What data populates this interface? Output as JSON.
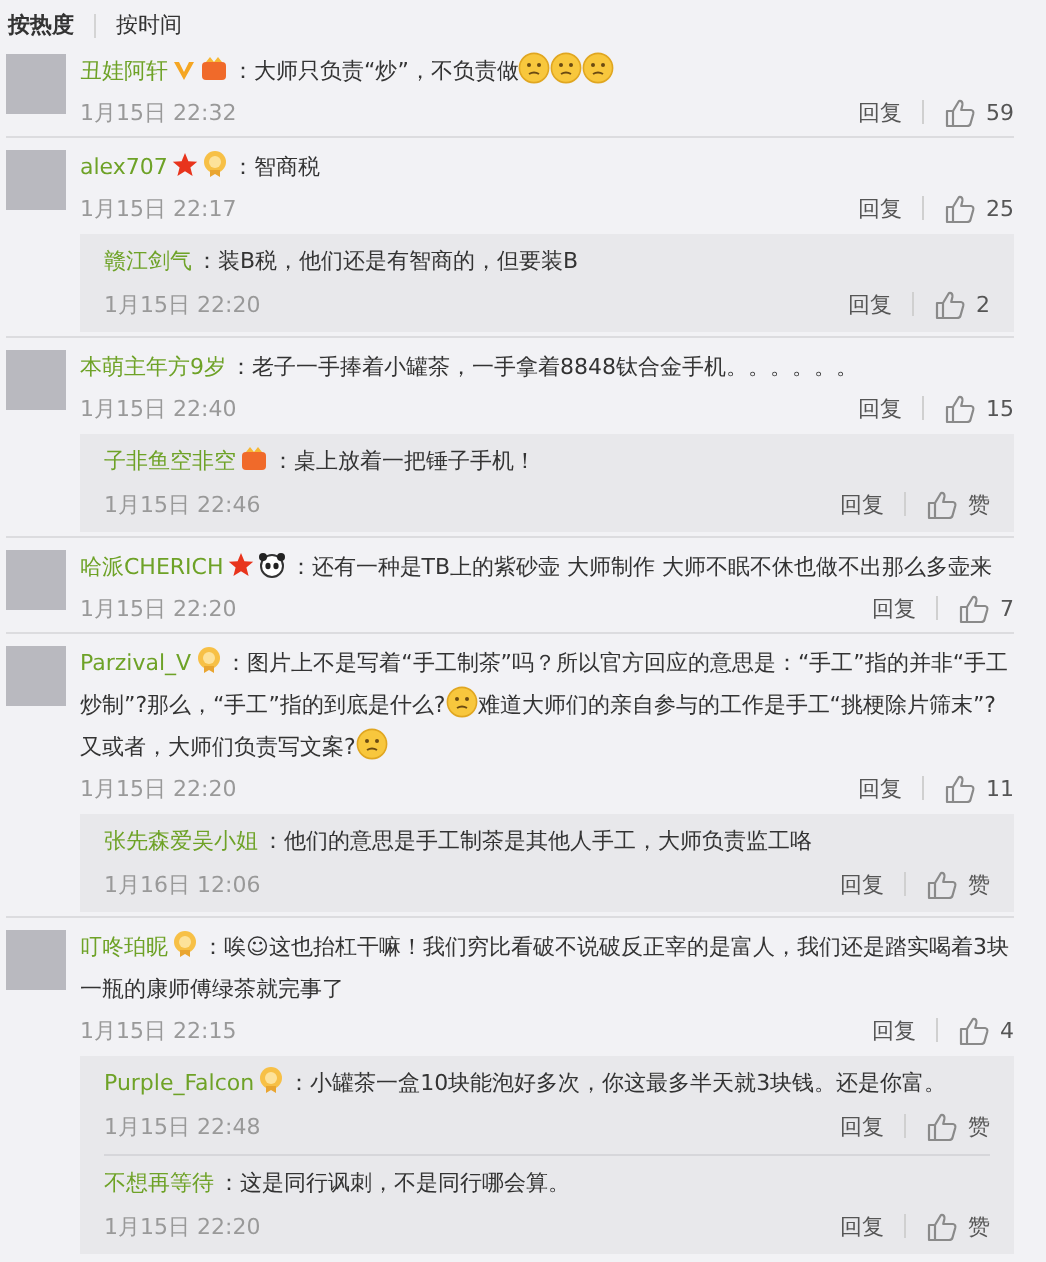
{
  "sort_tabs": [
    {
      "label": "按热度",
      "selected": true
    },
    {
      "label": "按时间",
      "selected": false
    }
  ],
  "comments": [
    {
      "user": "丑娃阿轩",
      "badges": [
        {
          "kind": "verified"
        },
        {
          "kind": "vip"
        }
      ],
      "content": [
        {
          "kind": "text",
          "text": "：大师只负责“炒”，不负责做"
        },
        {
          "kind": "emoticon"
        },
        {
          "kind": "emoticon"
        },
        {
          "kind": "emoticon"
        }
      ],
      "time": "1月15日 22:32",
      "reply_label": "回复",
      "likes": "59"
    },
    {
      "user": "alex707",
      "badges": [
        {
          "kind": "star"
        },
        {
          "kind": "medal"
        }
      ],
      "content": [
        {
          "kind": "text",
          "text": "：智商税"
        }
      ],
      "time": "1月15日 22:17",
      "reply_label": "回复",
      "likes": "25",
      "replies": [
        {
          "user": "赣江剑气",
          "content": [
            {
              "kind": "text",
              "text": "：装B税，他们还是有智商的，但要装B"
            }
          ],
          "time": "1月15日 22:20",
          "reply_label": "回复",
          "likes": "2"
        }
      ]
    },
    {
      "user": "本萌主年方9岁",
      "content": [
        {
          "kind": "text",
          "text": "：老子一手捧着小罐茶，一手拿着8848钛合金手机。。。。。。"
        }
      ],
      "time": "1月15日 22:40",
      "reply_label": "回复",
      "likes": "15",
      "replies": [
        {
          "user": "子非鱼空非空",
          "badges": [
            {
              "kind": "vip"
            }
          ],
          "content": [
            {
              "kind": "text",
              "text": "：桌上放着一把锤子手机！"
            }
          ],
          "time": "1月15日 22:46",
          "reply_label": "回复",
          "likes": "赞"
        }
      ]
    },
    {
      "user": "哈派CHERICH",
      "badges": [
        {
          "kind": "star"
        },
        {
          "kind": "panda"
        }
      ],
      "content": [
        {
          "kind": "text",
          "text": "：还有一种是TB上的紫砂壶 大师制作 大师不眠不休也做不出那么多壶来"
        }
      ],
      "time": "1月15日 22:20",
      "reply_label": "回复",
      "likes": "7"
    },
    {
      "user": "Parzival_V",
      "badges": [
        {
          "kind": "medal"
        }
      ],
      "content": [
        {
          "kind": "text",
          "text": "：图片上不是写着“手工制茶”吗？所以官方回应的意思是：“手工”指的并非“手工炒制”?那么，“手工”指的到底是什么?"
        },
        {
          "kind": "emoticon"
        },
        {
          "kind": "text",
          "text": "难道大师们的亲自参与的工作是手工“挑梗除片筛末”?又或者，大师们负责写文案?"
        },
        {
          "kind": "emoticon"
        }
      ],
      "time": "1月15日 22:20",
      "reply_label": "回复",
      "likes": "11",
      "replies": [
        {
          "user": "张先森爱吴小姐",
          "content": [
            {
              "kind": "text",
              "text": "：他们的意思是手工制茶是其他人手工，大师负责监工咯"
            }
          ],
          "time": "1月16日 12:06",
          "reply_label": "回复",
          "likes": "赞"
        }
      ]
    },
    {
      "user": "叮咚珀昵",
      "badges": [
        {
          "kind": "medal"
        }
      ],
      "content": [
        {
          "kind": "text",
          "text": "：唉☺这也抬杠干嘛！我们穷比看破不说破反正宰的是富人，我们还是踏实喝着3块一瓶的康师傅绿茶就完事了"
        }
      ],
      "time": "1月15日 22:15",
      "reply_label": "回复",
      "likes": "4",
      "replies": [
        {
          "user": "Purple_Falcon",
          "badges": [
            {
              "kind": "medal"
            }
          ],
          "content": [
            {
              "kind": "text",
              "text": "：小罐茶一盒10块能泡好多次，你这最多半天就3块钱。还是你富。"
            }
          ],
          "time": "1月15日 22:48",
          "reply_label": "回复",
          "likes": "赞"
        },
        {
          "user": "不想再等待",
          "content": [
            {
              "kind": "text",
              "text": "：这是同行讽刺，不是同行哪会算。"
            }
          ],
          "time": "1月15日 22:20",
          "reply_label": "回复",
          "likes": "赞"
        }
      ]
    }
  ]
}
